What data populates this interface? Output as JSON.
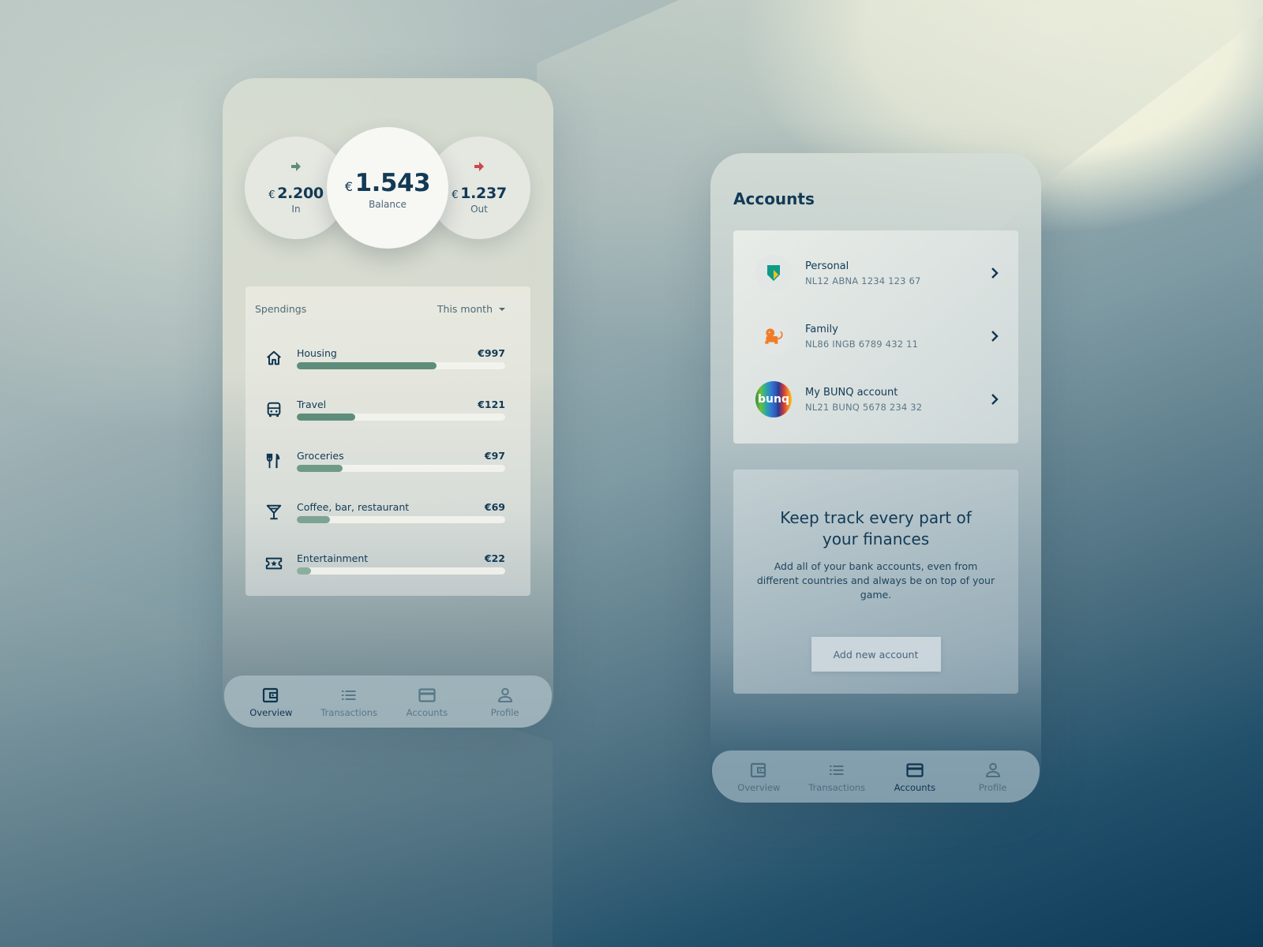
{
  "overview": {
    "stats": {
      "in": {
        "currency": "€",
        "amount": "2.200",
        "label": "In"
      },
      "balance": {
        "currency": "€",
        "amount": "1.543",
        "label": "Balance"
      },
      "out": {
        "currency": "€",
        "amount": "1.237",
        "label": "Out"
      }
    },
    "spendings": {
      "title": "Spendings",
      "period": "This month",
      "categories": [
        {
          "name": "Housing",
          "value": "€997",
          "icon": "home-icon",
          "fill": 0.67
        },
        {
          "name": "Travel",
          "value": "€121",
          "icon": "bus-icon",
          "fill": 0.28
        },
        {
          "name": "Groceries",
          "value": "€97",
          "icon": "fork-knife-icon",
          "fill": 0.22
        },
        {
          "name": "Coffee, bar, restaurant",
          "value": "€69",
          "icon": "cocktail-icon",
          "fill": 0.16
        },
        {
          "name": "Entertainment",
          "value": "€22",
          "icon": "ticket-icon",
          "fill": 0.07
        }
      ]
    },
    "tabs": [
      {
        "label": "Overview",
        "icon": "wallet-icon",
        "active": true
      },
      {
        "label": "Transactions",
        "icon": "list-icon",
        "active": false
      },
      {
        "label": "Accounts",
        "icon": "card-icon",
        "active": false
      },
      {
        "label": "Profile",
        "icon": "user-icon",
        "active": false
      }
    ]
  },
  "accounts": {
    "title": "Accounts",
    "list": [
      {
        "name": "Personal",
        "iban": "NL12 ABNA 1234 123 67",
        "logo": "abn-amro-logo"
      },
      {
        "name": "Family",
        "iban": "NL86 INGB 6789 432 11",
        "logo": "ing-lion-logo"
      },
      {
        "name": "My BUNQ account",
        "iban": "NL21 BUNQ 5678 234 32",
        "logo": "bunq-logo",
        "logo_text": "bunq"
      }
    ],
    "promo": {
      "title": "Keep track every part of your finances",
      "text": "Add all of your bank accounts, even from different countries and always be on top of your game.",
      "button": "Add new account"
    },
    "tabs": [
      {
        "label": "Overview",
        "icon": "wallet-icon",
        "active": false
      },
      {
        "label": "Transactions",
        "icon": "list-icon",
        "active": false
      },
      {
        "label": "Accounts",
        "icon": "card-icon",
        "active": true
      },
      {
        "label": "Profile",
        "icon": "user-icon",
        "active": false
      }
    ]
  },
  "colors": {
    "primary_text": "#123a56",
    "bar_fill": "#5e8e7b",
    "in_arrow": "#5e8e7b",
    "out_arrow": "#c84a4a"
  }
}
